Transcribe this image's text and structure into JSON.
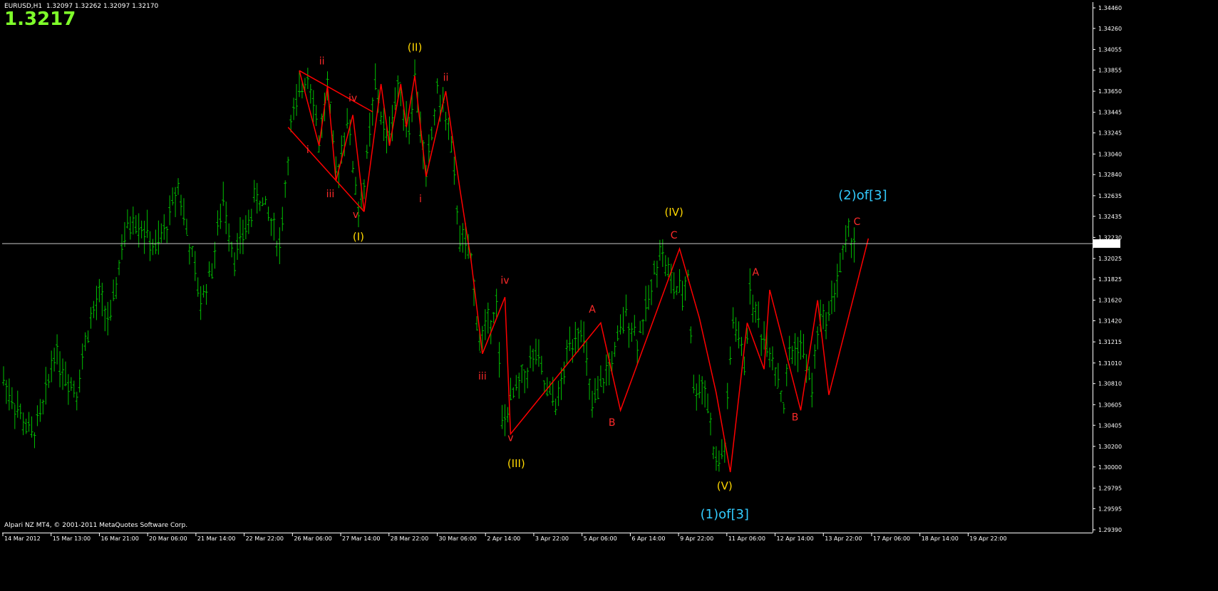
{
  "header": {
    "symbol_line": "EURUSD,H1  1.32097 1.32262 1.32097 1.32170",
    "big_price": "1.3217"
  },
  "footer": {
    "copyright": "Alpari NZ MT4, © 2001-2011 MetaQuotes Software Corp."
  },
  "colors": {
    "background": "#000000",
    "candles": "#00c000",
    "wave_lines": "#ff0000",
    "primary_labels": "#ffd700",
    "minor_labels": "#ff2a2a",
    "degree_labels": "#33ccff",
    "axis": "#ffffff",
    "big_price": "#7fff2a"
  },
  "chart_data": {
    "type": "line",
    "title": "EURUSD,H1",
    "current_price": 1.3217,
    "current_price_label": "1.32170",
    "ylim": [
      1.2939,
      1.3446
    ],
    "y_ticks": [
      "1.34460",
      "1.34260",
      "1.34055",
      "1.33855",
      "1.33650",
      "1.33445",
      "1.33245",
      "1.33040",
      "1.32840",
      "1.32635",
      "1.32435",
      "1.32230",
      "1.32025",
      "1.31825",
      "1.31620",
      "1.31420",
      "1.31215",
      "1.31010",
      "1.30810",
      "1.30605",
      "1.30405",
      "1.30200",
      "1.30000",
      "1.29795",
      "1.29595",
      "1.29390"
    ],
    "x_ticks": [
      "14 Mar 2012",
      "15 Mar 13:00",
      "16 Mar 21:00",
      "20 Mar 06:00",
      "21 Mar 14:00",
      "22 Mar 22:00",
      "26 Mar 06:00",
      "27 Mar 14:00",
      "28 Mar 22:00",
      "30 Mar 06:00",
      "2 Apr 14:00",
      "3 Apr 22:00",
      "5 Apr 06:00",
      "6 Apr 14:00",
      "9 Apr 22:00",
      "11 Apr 06:00",
      "12 Apr 14:00",
      "13 Apr 22:00",
      "17 Apr 06:00",
      "18 Apr 14:00",
      "19 Apr 22:00"
    ],
    "price_path_ticks": [
      [
        0,
        1.3085
      ],
      [
        6,
        1.305
      ],
      [
        10,
        1.303
      ],
      [
        14,
        1.3055
      ],
      [
        18,
        1.3115
      ],
      [
        22,
        1.309
      ],
      [
        26,
        1.3075
      ],
      [
        30,
        1.3135
      ],
      [
        34,
        1.3165
      ],
      [
        38,
        1.314
      ],
      [
        42,
        1.3215
      ],
      [
        46,
        1.3245
      ],
      [
        50,
        1.323
      ],
      [
        54,
        1.321
      ],
      [
        58,
        1.3235
      ],
      [
        62,
        1.3275
      ],
      [
        66,
        1.3215
      ],
      [
        70,
        1.316
      ],
      [
        74,
        1.3195
      ],
      [
        78,
        1.326
      ],
      [
        82,
        1.3205
      ],
      [
        86,
        1.323
      ],
      [
        90,
        1.3265
      ],
      [
        94,
        1.3245
      ],
      [
        98,
        1.3215
      ],
      [
        102,
        1.333
      ],
      [
        106,
        1.337
      ],
      [
        108,
        1.3385
      ],
      [
        110,
        1.336
      ],
      [
        112,
        1.3315
      ],
      [
        115,
        1.337
      ],
      [
        118,
        1.328
      ],
      [
        122,
        1.334
      ],
      [
        126,
        1.325
      ],
      [
        128,
        1.3275
      ],
      [
        132,
        1.337
      ],
      [
        136,
        1.3315
      ],
      [
        140,
        1.337
      ],
      [
        144,
        1.333
      ],
      [
        146,
        1.338
      ],
      [
        150,
        1.328
      ],
      [
        154,
        1.3365
      ],
      [
        158,
        1.333
      ],
      [
        162,
        1.3225
      ],
      [
        166,
        1.32
      ],
      [
        169,
        1.312
      ],
      [
        172,
        1.314
      ],
      [
        175,
        1.316
      ],
      [
        177,
        1.304
      ],
      [
        181,
        1.307
      ],
      [
        185,
        1.309
      ],
      [
        189,
        1.311
      ],
      [
        193,
        1.307
      ],
      [
        197,
        1.3065
      ],
      [
        201,
        1.312
      ],
      [
        205,
        1.314
      ],
      [
        209,
        1.3055
      ],
      [
        213,
        1.3085
      ],
      [
        217,
        1.311
      ],
      [
        221,
        1.315
      ],
      [
        225,
        1.3125
      ],
      [
        229,
        1.316
      ],
      [
        233,
        1.3215
      ],
      [
        237,
        1.318
      ],
      [
        241,
        1.3165
      ],
      [
        243,
        1.319
      ],
      [
        245,
        1.3075
      ],
      [
        249,
        1.308
      ],
      [
        253,
        1.3
      ],
      [
        256,
        1.302
      ],
      [
        259,
        1.3145
      ],
      [
        263,
        1.31
      ],
      [
        265,
        1.317
      ],
      [
        269,
        1.313
      ],
      [
        273,
        1.311
      ],
      [
        277,
        1.306
      ],
      [
        279,
        1.311
      ],
      [
        283,
        1.312
      ],
      [
        287,
        1.3075
      ],
      [
        289,
        1.3135
      ],
      [
        293,
        1.315
      ],
      [
        297,
        1.3195
      ],
      [
        300,
        1.3225
      ],
      [
        302,
        1.322
      ]
    ],
    "wave_segments": [
      [
        [
          105,
          1.3385
        ],
        [
          112,
          1.3312
        ],
        [
          115,
          1.337
        ],
        [
          118,
          1.3278
        ],
        [
          124,
          1.3342
        ],
        [
          128,
          1.3248
        ],
        [
          134,
          1.3372
        ],
        [
          137,
          1.3312
        ],
        [
          141,
          1.3372
        ],
        [
          143,
          1.333
        ],
        [
          146,
          1.338
        ],
        [
          150,
          1.3282
        ],
        [
          157,
          1.3365
        ],
        [
          162,
          1.327
        ],
        [
          166,
          1.32
        ],
        [
          170,
          1.311
        ],
        [
          178,
          1.3165
        ],
        [
          180,
          1.3032
        ],
        [
          212,
          1.314
        ],
        [
          219,
          1.3055
        ],
        [
          240,
          1.3212
        ],
        [
          247,
          1.3145
        ],
        [
          253,
          1.3072
        ],
        [
          258,
          1.2995
        ],
        [
          264,
          1.314
        ],
        [
          270,
          1.3095
        ],
        [
          272,
          1.3172
        ],
        [
          283,
          1.3055
        ],
        [
          289,
          1.3162
        ],
        [
          293,
          1.307
        ],
        [
          307,
          1.3222
        ]
      ],
      [
        [
          101,
          1.333
        ],
        [
          128,
          1.3248
        ]
      ],
      [
        [
          105,
          1.3385
        ],
        [
          131,
          1.3345
        ]
      ]
    ],
    "wave_labels": [
      {
        "text": "ii",
        "x": 113,
        "y": 1.3391,
        "kind": "minor"
      },
      {
        "text": "iv",
        "x": 124,
        "y": 1.3355,
        "kind": "minor"
      },
      {
        "text": "i",
        "x": 108,
        "y": 1.3305,
        "kind": "minor"
      },
      {
        "text": "iii",
        "x": 116,
        "y": 1.3262,
        "kind": "minor"
      },
      {
        "text": "v",
        "x": 125,
        "y": 1.3242,
        "kind": "minor"
      },
      {
        "text": "(I)",
        "x": 126,
        "y": 1.322,
        "kind": "primary"
      },
      {
        "text": "(II)",
        "x": 146,
        "y": 1.3404,
        "kind": "primary"
      },
      {
        "text": "ii",
        "x": 157,
        "y": 1.3375,
        "kind": "minor"
      },
      {
        "text": "i",
        "x": 148,
        "y": 1.3257,
        "kind": "minor"
      },
      {
        "text": "iv",
        "x": 178,
        "y": 1.3178,
        "kind": "minor"
      },
      {
        "text": "iii",
        "x": 170,
        "y": 1.3085,
        "kind": "minor"
      },
      {
        "text": "v",
        "x": 180,
        "y": 1.3025,
        "kind": "minor"
      },
      {
        "text": "(III)",
        "x": 182,
        "y": 1.3,
        "kind": "primary"
      },
      {
        "text": "A",
        "x": 209,
        "y": 1.315,
        "kind": "minor"
      },
      {
        "text": "B",
        "x": 216,
        "y": 1.304,
        "kind": "minor"
      },
      {
        "text": "(IV)",
        "x": 238,
        "y": 1.3244,
        "kind": "primary"
      },
      {
        "text": "C",
        "x": 238,
        "y": 1.3222,
        "kind": "minor"
      },
      {
        "text": "(V)",
        "x": 256,
        "y": 1.2978,
        "kind": "primary"
      },
      {
        "text": "(1)of[3]",
        "x": 256,
        "y": 1.295,
        "kind": "degree"
      },
      {
        "text": "A",
        "x": 267,
        "y": 1.3186,
        "kind": "minor"
      },
      {
        "text": "B",
        "x": 281,
        "y": 1.3045,
        "kind": "minor"
      },
      {
        "text": "C",
        "x": 303,
        "y": 1.3235,
        "kind": "minor"
      },
      {
        "text": "(2)of[3]",
        "x": 305,
        "y": 1.326,
        "kind": "degree"
      }
    ],
    "xlabel": "",
    "ylabel": "",
    "grid": false,
    "legend": "none"
  }
}
